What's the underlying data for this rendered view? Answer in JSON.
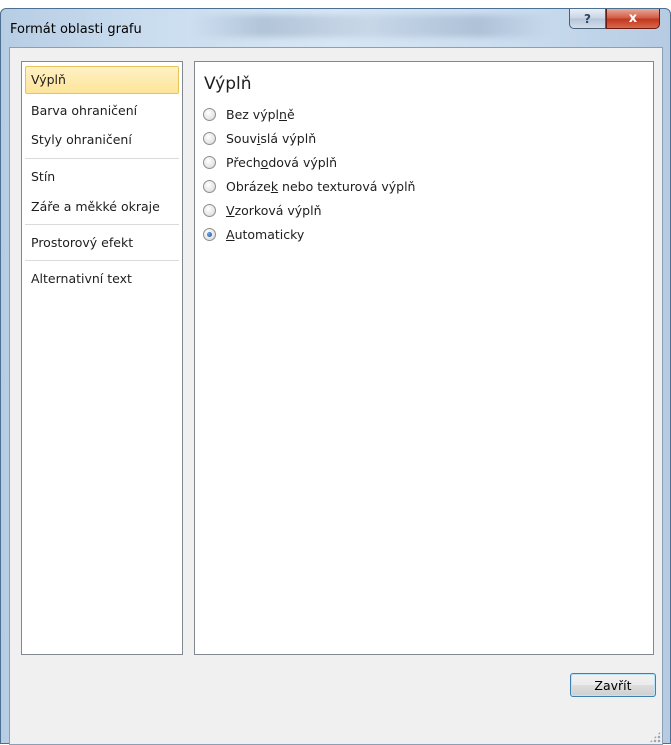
{
  "window": {
    "title": "Formát oblasti grafu",
    "help_label": "?",
    "close_label": "x"
  },
  "nav": {
    "items": [
      {
        "label": "Výplň",
        "selected": true
      },
      {
        "label": "Barva ohraničení",
        "selected": false
      },
      {
        "label": "Styly ohraničení",
        "selected": false
      },
      {
        "label": "Stín",
        "selected": false
      },
      {
        "label": "Záře a měkké okraje",
        "selected": false
      },
      {
        "label": "Prostorový efekt",
        "selected": false
      },
      {
        "label": "Alternativní text",
        "selected": false
      }
    ]
  },
  "panel": {
    "title": "Výplň",
    "options": [
      {
        "pre": "Bez výpl",
        "key": "n",
        "post": "ě",
        "checked": false
      },
      {
        "pre": "Souv",
        "key": "i",
        "post": "slá výplň",
        "checked": false
      },
      {
        "pre": "Přech",
        "key": "o",
        "post": "dová výplň",
        "checked": false
      },
      {
        "pre": "Obráze",
        "key": "k",
        "post": " nebo texturová výplň",
        "checked": false
      },
      {
        "pre": "",
        "key": "V",
        "post": "zorková výplň",
        "checked": false
      },
      {
        "pre": "",
        "key": "A",
        "post": "utomaticky",
        "checked": true
      }
    ]
  },
  "footer": {
    "close_button": "Zavřít"
  },
  "colors": {
    "selection_fill": "#fde59a",
    "selection_border": "#e8c25a",
    "close_red": "#c2371f",
    "button_focus_border": "#3c7fb1"
  }
}
